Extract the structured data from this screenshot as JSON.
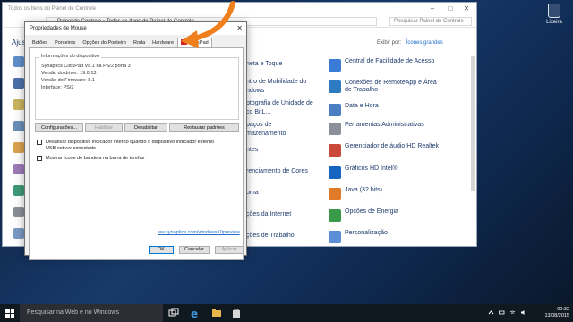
{
  "control_panel": {
    "title": "Todos os Itens do Painel de Controle",
    "breadcrumb": [
      "Painel de Controle",
      "Todos os Itens do Painel de Controle"
    ],
    "search_placeholder": "Pesquisar Painel de Controle",
    "heading": "Ajust",
    "view_by_label": "Exibir por:",
    "view_by_value": "Ícones grandes",
    "middle_items": [
      "neta e Toque",
      "ntro de Mobilidade do",
      "ndows",
      "ptografia de Unidade de",
      "co BitL...",
      "paços de",
      "mazenamento",
      "ntes",
      "renciamento de Cores",
      "oma",
      "ções da Internet",
      "ções de Trabalho"
    ],
    "right_items": [
      {
        "label": "Central de Facilidade de Acesso",
        "color": "#3a7bd5"
      },
      {
        "label": "Conexões de RemoteApp e Área de Trabalho",
        "color": "#2e7bc4"
      },
      {
        "label": "Data e Hora",
        "color": "#4a7fc1"
      },
      {
        "label": "Ferramentas Administrativas",
        "color": "#8a8f99"
      },
      {
        "label": "Gerenciador de áudio HD Realtek",
        "color": "#c94a3a"
      },
      {
        "label": "Gráficos HD Intel®",
        "color": "#1565c0"
      },
      {
        "label": "Java (32 bits)",
        "color": "#e07b2a"
      },
      {
        "label": "Opções de Energia",
        "color": "#3a9a4a"
      },
      {
        "label": "Personalização",
        "color": "#5b8fd6"
      }
    ]
  },
  "dialog": {
    "title": "Propriedades de Mouse",
    "tabs": [
      "Botões",
      "Ponteiros",
      "Opções do Ponteiro",
      "Roda",
      "Hardware",
      "ClickPad"
    ],
    "active_tab": "ClickPad",
    "group_title": "Informações do dispositivo",
    "device_lines": [
      "Synaptics ClickPad V8.1 na PS/2 porta 3",
      "Versão do driver: 19.0.13",
      "Versão do Firmware: 8.1",
      "Interface: PS/2"
    ],
    "buttons": {
      "config": "Configurações...",
      "enable": "Habilitar",
      "disable": "Desabilitar",
      "restore": "Restaurar padrões"
    },
    "checkbox1": "Desativar dispositivo indicador interno quando o dispositivo indicador externo USB estiver conectado",
    "checkbox2": "Mostrar ícone de bandeja na barra de tarefas",
    "link": "ww.synaptics.com/windows10preview",
    "ok": "OK",
    "cancel": "Cancelar",
    "apply": "Aplicar"
  },
  "desktop": {
    "recycle_bin": "Lixeira"
  },
  "taskbar": {
    "search_placeholder": "Pesquisar na Web e no Windows",
    "time": "00:32",
    "date": "13/08/2015"
  }
}
